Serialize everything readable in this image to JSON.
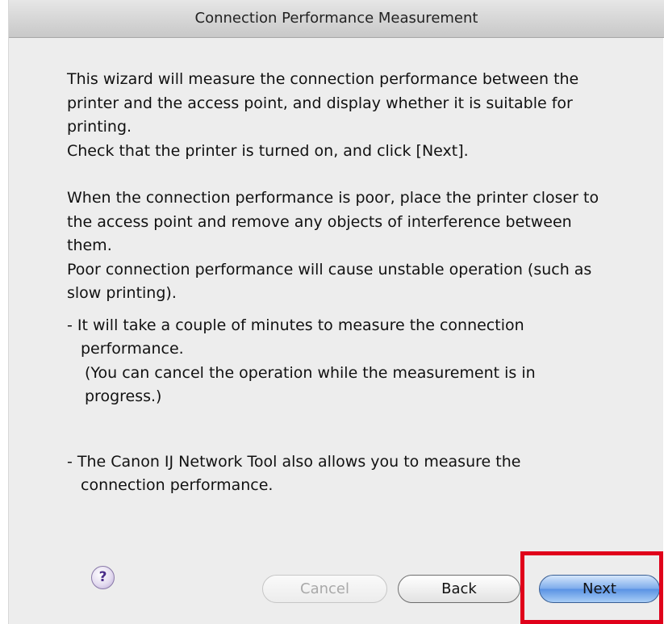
{
  "window": {
    "title": "Connection Performance Measurement"
  },
  "content": {
    "para1": [
      "This wizard will measure the connection performance between the",
      "printer and the access point, and display whether it is suitable for",
      "printing.",
      "Check that the printer is turned on, and click [Next]."
    ],
    "para2": [
      "When the connection performance is poor, place the printer closer to",
      "the access point and remove any objects of interference between",
      "them.",
      "Poor connection performance will cause unstable operation (such as",
      "slow printing)."
    ],
    "note1": [
      "- It will take a couple of minutes to measure the connection",
      "performance.",
      "(You can cancel the operation while the measurement is in",
      "progress.)"
    ],
    "note2": [
      "- The Canon IJ Network Tool also allows you to measure the",
      "connection performance."
    ]
  },
  "footer": {
    "help_glyph": "?",
    "help_icon": "help-question-icon",
    "cancel_label": "Cancel",
    "back_label": "Back",
    "next_label": "Next"
  },
  "colors": {
    "highlight": "#e0001a",
    "next_button": "#5a93e4",
    "window_background": "#ededed"
  }
}
